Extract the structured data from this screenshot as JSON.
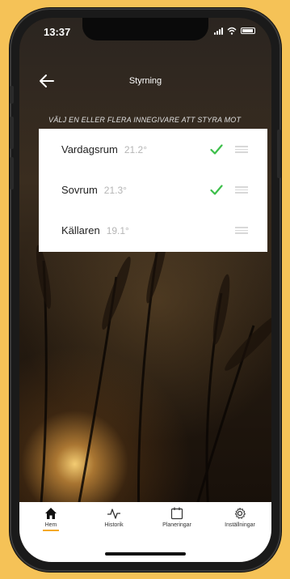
{
  "status_bar": {
    "time": "13:37",
    "icons": [
      "signal-icon",
      "wifi-icon",
      "battery-icon"
    ]
  },
  "header": {
    "title": "Styrning",
    "back_icon": "arrow-left-icon"
  },
  "instruction": "VÄLJ EN ELLER FLERA INNEGIVARE ATT STYRA MOT",
  "sensors": [
    {
      "name": "Vardagsrum",
      "temp": "21.2°",
      "selected": true
    },
    {
      "name": "Sovrum",
      "temp": "21.3°",
      "selected": true
    },
    {
      "name": "Källaren",
      "temp": "19.1°",
      "selected": false
    }
  ],
  "tabs": [
    {
      "label": "Hem",
      "icon": "home-icon",
      "active": true
    },
    {
      "label": "Historik",
      "icon": "activity-icon",
      "active": false
    },
    {
      "label": "Planeringar",
      "icon": "calendar-icon",
      "active": false
    },
    {
      "label": "Inställningar",
      "icon": "gear-icon",
      "active": false
    }
  ],
  "colors": {
    "page_background": "#f5c257",
    "check": "#3cbf4a",
    "tab_active_underline": "#f4a928",
    "list_background": "#ffffff"
  }
}
